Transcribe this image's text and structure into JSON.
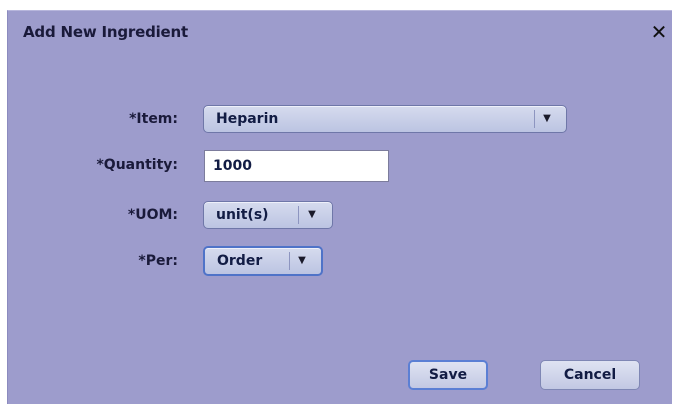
{
  "dialog": {
    "title": "Add New Ingredient",
    "close_icon": "close-icon"
  },
  "form": {
    "item_label": "*Item:",
    "item_value": "Heparin",
    "quantity_label": "*Quantity:",
    "quantity_value": "1000",
    "uom_label": "*UOM:",
    "uom_value": "unit(s)",
    "per_label": "*Per:",
    "per_value": "Order"
  },
  "buttons": {
    "save": "Save",
    "cancel": "Cancel"
  },
  "colors": {
    "dialog_background": "#9d9ccc",
    "focus_accent": "#4f73c8"
  }
}
